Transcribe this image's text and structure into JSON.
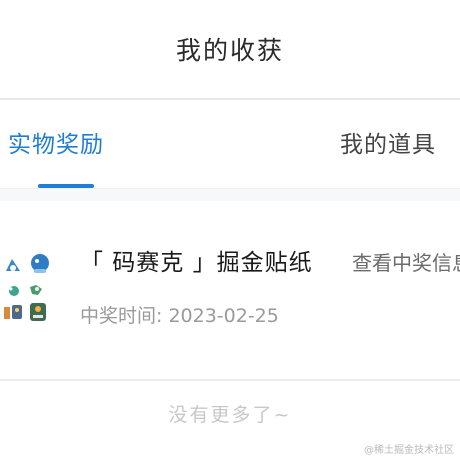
{
  "header": {
    "title": "我的收获"
  },
  "tabs": [
    {
      "label": "实物奖励",
      "active": true
    },
    {
      "label": "我的道具",
      "active": false
    }
  ],
  "colors": {
    "accent": "#1f7dd8"
  },
  "prizes": [
    {
      "title": "「 码赛克 」掘金贴纸",
      "link_label": "查看中奖信息",
      "date_label": "中奖时间: 2023-02-25",
      "image_icon": "sticker-pack-icon"
    }
  ],
  "footer": {
    "end_text": "没有更多了~",
    "watermark": "@稀土掘金技术社区"
  }
}
